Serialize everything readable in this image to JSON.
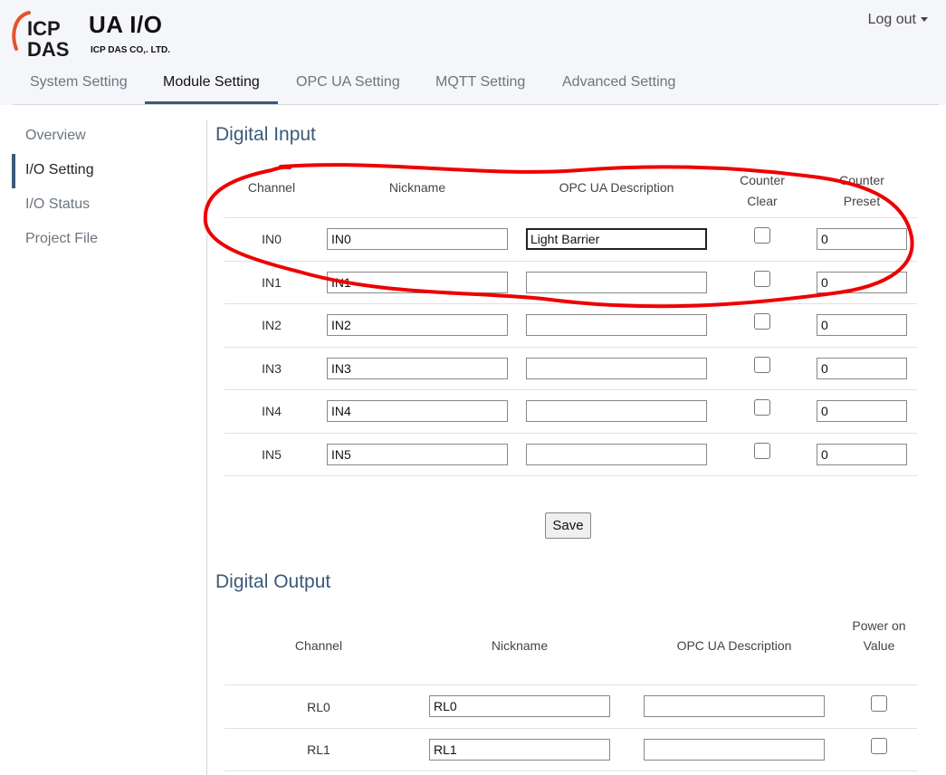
{
  "header": {
    "logo_top": "ICP",
    "logo_bottom": "DAS",
    "app_title": "UA I/O",
    "company": "ICP DAS CO,. LTD.",
    "logout_label": "Log out"
  },
  "tabs": [
    {
      "label": "System Setting",
      "active": false
    },
    {
      "label": "Module Setting",
      "active": true
    },
    {
      "label": "OPC UA Setting",
      "active": false
    },
    {
      "label": "MQTT Setting",
      "active": false
    },
    {
      "label": "Advanced Setting",
      "active": false
    }
  ],
  "sidebar": {
    "items": [
      {
        "label": "Overview",
        "active": false
      },
      {
        "label": "I/O Setting",
        "active": true
      },
      {
        "label": "I/O Status",
        "active": false
      },
      {
        "label": "Project File",
        "active": false
      }
    ]
  },
  "digital_input": {
    "title": "Digital Input",
    "headers": {
      "channel": "Channel",
      "nickname": "Nickname",
      "description": "OPC UA Description",
      "counter_clear": "Counter Clear",
      "counter_preset": "Counter Preset"
    },
    "rows": [
      {
        "channel": "IN0",
        "nickname": "IN0",
        "description": "Light Barrier",
        "counter_clear": false,
        "counter_preset": "0"
      },
      {
        "channel": "IN1",
        "nickname": "IN1",
        "description": "",
        "counter_clear": false,
        "counter_preset": "0"
      },
      {
        "channel": "IN2",
        "nickname": "IN2",
        "description": "",
        "counter_clear": false,
        "counter_preset": "0"
      },
      {
        "channel": "IN3",
        "nickname": "IN3",
        "description": "",
        "counter_clear": false,
        "counter_preset": "0"
      },
      {
        "channel": "IN4",
        "nickname": "IN4",
        "description": "",
        "counter_clear": false,
        "counter_preset": "0"
      },
      {
        "channel": "IN5",
        "nickname": "IN5",
        "description": "",
        "counter_clear": false,
        "counter_preset": "0"
      }
    ],
    "save_label": "Save"
  },
  "digital_output": {
    "title": "Digital Output",
    "headers": {
      "channel": "Channel",
      "nickname": "Nickname",
      "description": "OPC UA Description",
      "power_on_value": "Power on Value"
    },
    "rows": [
      {
        "channel": "RL0",
        "nickname": "RL0",
        "description": "",
        "power_on_value": false
      },
      {
        "channel": "RL1",
        "nickname": "RL1",
        "description": "",
        "power_on_value": false
      }
    ]
  },
  "colors": {
    "accent": "#3a5a78",
    "logo_orange": "#e5532d",
    "annotation_red": "#ee0000"
  }
}
